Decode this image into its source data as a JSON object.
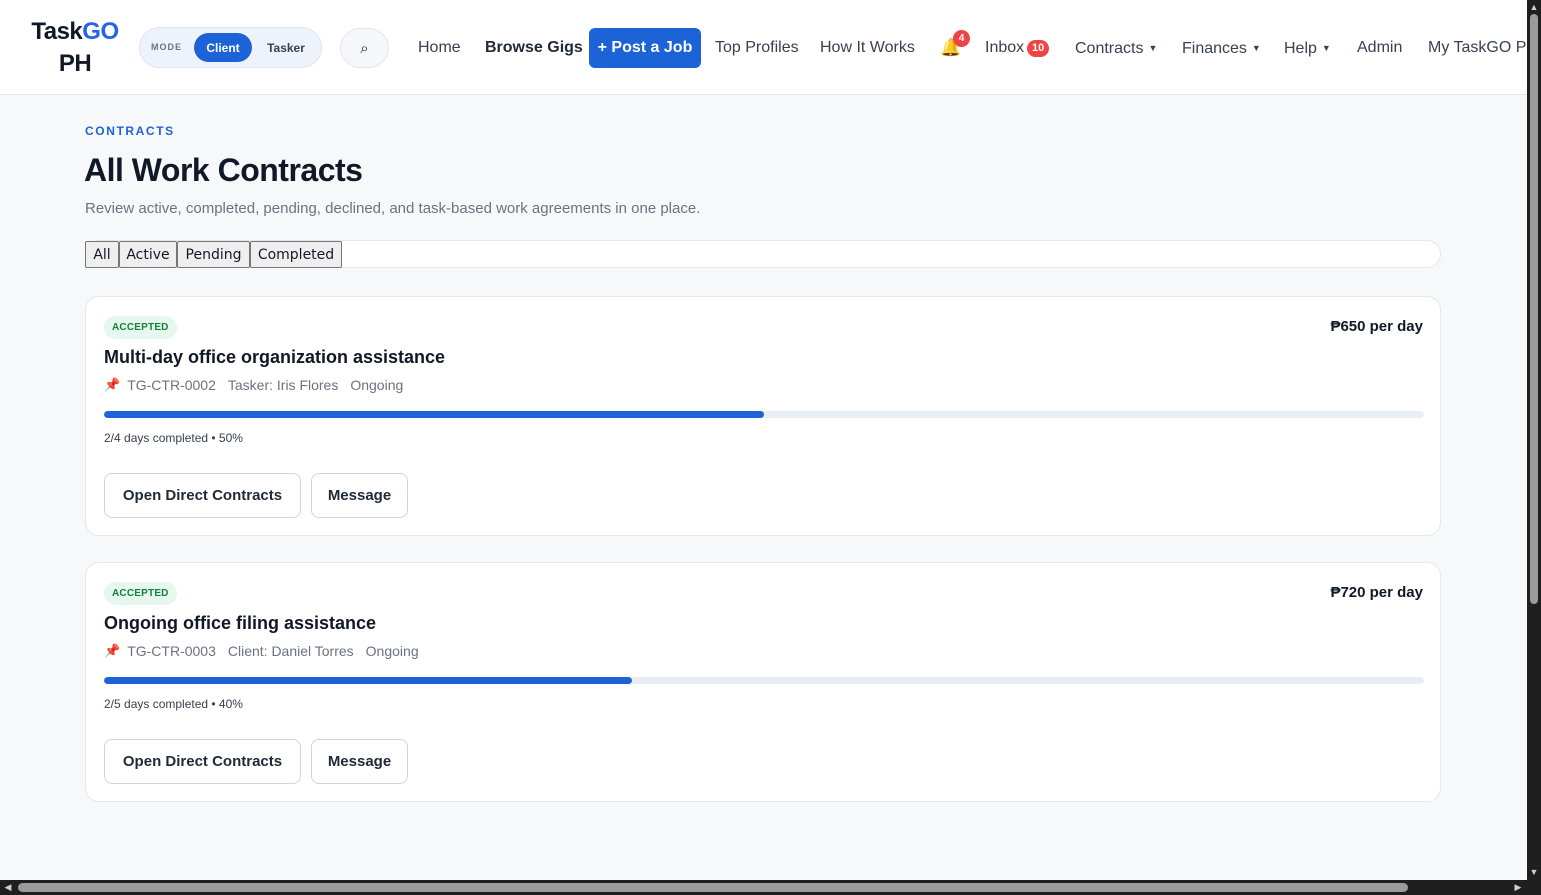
{
  "nav": {
    "logo_part1": "Task",
    "logo_part2": "GO",
    "logo_part3": "PH",
    "mode_label": "MODE",
    "mode_client": "Client",
    "mode_tasker": "Tasker",
    "search_icon": "⌕",
    "home": "Home",
    "browse_gigs": "Browse Gigs",
    "post_job": "+ Post a Job",
    "top_profiles": "Top Profiles",
    "how_it_works": "How It Works",
    "bell_icon": "🔔",
    "notifications_count": "4",
    "inbox": "Inbox",
    "inbox_count": "10",
    "contracts": "Contracts",
    "finances": "Finances",
    "help": "Help",
    "admin": "Admin",
    "my_account": "My TaskGO PH",
    "caret": "▼"
  },
  "header": {
    "eyebrow": "CONTRACTS",
    "title": "All Work Contracts",
    "subtitle": "Review active, completed, pending, declined, and task-based work agreements in one place."
  },
  "filters": [
    "All",
    "Active",
    "Pending",
    "Completed"
  ],
  "contracts": [
    {
      "status": "ACCEPTED",
      "rate": "₱650 per day",
      "title": "Multi-day office organization assistance",
      "pin_icon": "📌",
      "id": "TG-CTR-0002",
      "party": "Tasker: Iris Flores",
      "state": "Ongoing",
      "progress_fraction": 0.5,
      "progress_text": "2/4 days completed • 50%",
      "primary_button": "Open Direct Contracts",
      "secondary_button": "Message"
    },
    {
      "status": "ACCEPTED",
      "rate": "₱720 per day",
      "title": "Ongoing office filing assistance",
      "pin_icon": "📌",
      "id": "TG-CTR-0003",
      "party": "Client: Daniel Torres",
      "state": "Ongoing",
      "progress_fraction": 0.4,
      "progress_text": "2/5 days completed • 40%",
      "primary_button": "Open Direct Contracts",
      "secondary_button": "Message"
    }
  ],
  "colors": {
    "accent": "#1d63d8",
    "badge_bg": "#e6f7ee",
    "badge_text": "#15803d",
    "notification_badge": "#ef4444",
    "bell": "#f59e0b"
  },
  "scrollbar": {
    "up": "▲",
    "down": "▼",
    "left": "◀",
    "right": "▶"
  }
}
